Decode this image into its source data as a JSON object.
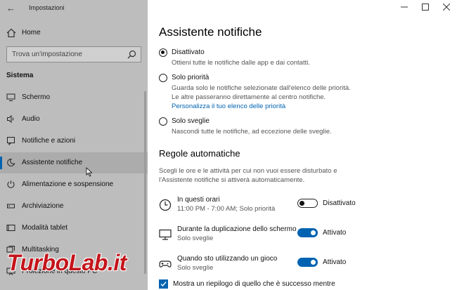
{
  "window": {
    "title": "Impostazioni",
    "minimize_icon": "minimize-icon",
    "maximize_icon": "maximize-icon",
    "close_icon": "close-icon"
  },
  "sidebar": {
    "home_label": "Home",
    "search_placeholder": "Trova un'impostazione",
    "section_title": "Sistema",
    "items": [
      {
        "label": "Schermo",
        "icon": "monitor-icon"
      },
      {
        "label": "Audio",
        "icon": "speaker-icon"
      },
      {
        "label": "Notifiche e azioni",
        "icon": "notification-icon"
      },
      {
        "label": "Assistente notifiche",
        "icon": "moon-icon",
        "active": true
      },
      {
        "label": "Alimentazione e sospensione",
        "icon": "power-icon"
      },
      {
        "label": "Archiviazione",
        "icon": "storage-icon"
      },
      {
        "label": "Modalità tablet",
        "icon": "tablet-icon"
      },
      {
        "label": "Multitasking",
        "icon": "multitasking-icon"
      },
      {
        "label": "Proiezione in questo PC",
        "icon": "projection-icon"
      }
    ],
    "watermark": "TurboLab.it",
    "accent_color": "#0063b1"
  },
  "main": {
    "title": "Assistente notifiche",
    "options": [
      {
        "label": "Disattivato",
        "checked": true,
        "desc": [
          "Ottieni tutte le notifiche dalle app e dai contatti."
        ]
      },
      {
        "label": "Solo priorità",
        "checked": false,
        "desc": [
          "Guarda solo le notifiche selezionate dall'elenco delle priorità.",
          "Le altre passeranno direttamente al centro notifiche."
        ],
        "link": "Personalizza il tuo elenco delle priorità"
      },
      {
        "label": "Solo sveglie",
        "checked": false,
        "desc": [
          "Nascondi tutte le notifiche, ad eccezione delle sveglie."
        ]
      }
    ],
    "rules_title": "Regole automatiche",
    "rules_desc": "Scegli le ore e le attività per cui non vuoi essere disturbato e l'Assistente notifiche si attiverà automaticamente.",
    "rules": [
      {
        "title": "In questi orari",
        "sub": "11:00 PM - 7:00 AM; Solo priorità",
        "on": false,
        "state": "Disattivato",
        "icon": "clock-icon"
      },
      {
        "title": "Durante la duplicazione dello schermo",
        "sub": "Solo sveglie",
        "on": true,
        "state": "Attivato",
        "icon": "monitor-icon"
      },
      {
        "title": "Quando sto utilizzando un gioco",
        "sub": "Solo sveglie",
        "on": true,
        "state": "Attivato",
        "icon": "gamepad-icon"
      }
    ],
    "summary_checkbox": {
      "label": "Mostra un riepilogo di quello che è successo mentre",
      "checked": true
    }
  }
}
